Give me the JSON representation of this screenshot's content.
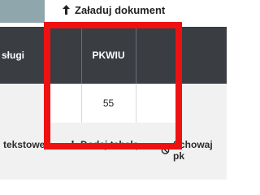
{
  "toolbar": {
    "upload_label": "Załaduj dokument"
  },
  "table": {
    "headers": [
      "sługi",
      "",
      "PKWIU",
      ""
    ],
    "row": {
      "pkwiu": "55"
    }
  },
  "actions": {
    "text_label": "tekstowe",
    "add_table_label": "Dodaj tabelę",
    "hide_label": "Schowaj pk"
  },
  "colors": {
    "header_bg": "#3a3d42",
    "highlight": "#ee1111",
    "body_bg": "#f1f1f1"
  },
  "icons": [
    "upload-arrow-icon",
    "plus-icon",
    "hide-icon"
  ]
}
